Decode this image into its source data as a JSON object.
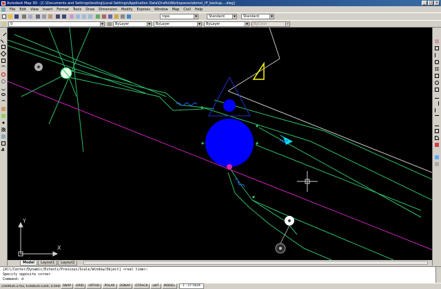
{
  "window": {
    "title": "Autodesk Map 3D - [C:\\Documents and Settings\\testing\\Local Settings\\Application Data\\Drafts\\Workspaces\\demo\\_IP_backup....dwg]",
    "minimize": "_",
    "maximize": "□",
    "close": "×"
  },
  "menu": {
    "items": [
      "File",
      "Edit",
      "View",
      "Insert",
      "Format",
      "Tools",
      "Draw",
      "Dimension",
      "Modify",
      "Express",
      "Window",
      "Map",
      "Civil",
      "Help"
    ]
  },
  "toolbar": {
    "layer_value": "0",
    "style_value": "rope",
    "dimstyle_value": "Standard",
    "textstyle_value": "Standard",
    "color_value": "ByLayer",
    "linetype_value": "ByLayer",
    "lineweight_value": "ByLayer",
    "plotstyle_value": "ByColor"
  },
  "tabs": [
    "Model",
    "Layout1",
    "Layout2"
  ],
  "ucs": {
    "y_label": "Y",
    "x_label": "X"
  },
  "command": {
    "lines": [
      "[All/Center/Dynamic/Extents/Previous/Scale/Window/Object] <real time>:",
      "Specify opposite corner",
      "Command: d"
    ]
  },
  "status": {
    "coords": "2569626.2762, 6168620.5344, 0.0000",
    "buttons": [
      "SNAP",
      "GRID",
      "ORTHO",
      "POLAR",
      "OSNAP",
      "OTRACK",
      "LWT",
      "MODEL"
    ],
    "scale": "1 : 27.5834"
  },
  "colors": {
    "background": "#000000",
    "green": "#2fbf6a",
    "magenta": "#d020c0",
    "blue": "#0000ff",
    "yellow": "#ffff00",
    "white": "#ffffff"
  }
}
